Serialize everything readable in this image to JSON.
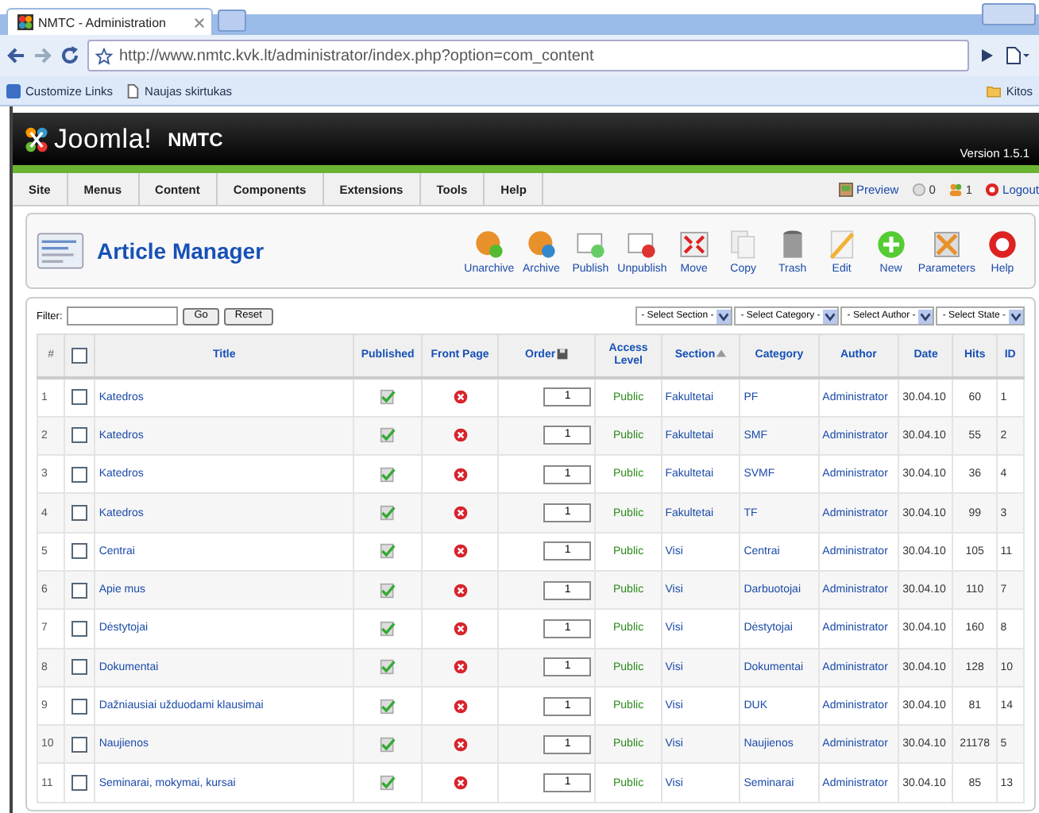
{
  "browser": {
    "tab_title": "NMTC - Administration",
    "url": "http://www.nmtc.kvk.lt/administrator/index.php?option=com_content",
    "bookmarks": [
      "Customize Links",
      "Naujas skirtukas"
    ],
    "other_bookmarks": "Kitos"
  },
  "header": {
    "brand": "Joomla!",
    "site_name": "NMTC",
    "version": "Version 1.5.1"
  },
  "menu": [
    "Site",
    "Menus",
    "Content",
    "Components",
    "Extensions",
    "Tools",
    "Help"
  ],
  "status": [
    {
      "kind": "preview",
      "label": "Preview"
    },
    {
      "kind": "messages",
      "label": "0"
    },
    {
      "kind": "users",
      "label": "1"
    },
    {
      "kind": "logout",
      "label": "Logout"
    }
  ],
  "toolbar": {
    "title": "Article Manager",
    "buttons": [
      {
        "kind": "unarchive",
        "label": "Unarchive"
      },
      {
        "kind": "archive",
        "label": "Archive"
      },
      {
        "kind": "publish",
        "label": "Publish"
      },
      {
        "kind": "unpublish",
        "label": "Unpublish"
      },
      {
        "kind": "move",
        "label": "Move"
      },
      {
        "kind": "copy",
        "label": "Copy"
      },
      {
        "kind": "trash",
        "label": "Trash"
      },
      {
        "kind": "edit",
        "label": "Edit"
      },
      {
        "kind": "new",
        "label": "New"
      },
      {
        "kind": "parameters",
        "label": "Parameters"
      },
      {
        "kind": "help",
        "label": "Help"
      }
    ]
  },
  "filter": {
    "label": "Filter:",
    "go": "Go",
    "reset": "Reset",
    "selects": [
      "- Select Section -",
      "- Select Category -",
      "- Select Author -",
      "- Select State -"
    ]
  },
  "table": {
    "columns": [
      {
        "label": "#",
        "kind": "text"
      },
      {
        "kind": "checkbox"
      },
      {
        "label": "Title",
        "kind": "text"
      },
      {
        "label": "Published",
        "kind": "text"
      },
      {
        "label": "Front Page",
        "kind": "text"
      },
      {
        "label": "Order",
        "kind": "order"
      },
      {
        "label": "Access Level",
        "kind": "text"
      },
      {
        "label": "Section",
        "kind": "sorted"
      },
      {
        "label": "Category",
        "kind": "text"
      },
      {
        "label": "Author",
        "kind": "text"
      },
      {
        "label": "Date",
        "kind": "text"
      },
      {
        "label": "Hits",
        "kind": "text"
      },
      {
        "label": "ID",
        "kind": "text"
      }
    ],
    "header_checked": false,
    "rows": [
      {
        "num": "1",
        "checked": false,
        "title": "Katedros",
        "published": true,
        "front_page": false,
        "order": "1",
        "access": "Public",
        "section": "Fakultetai",
        "category": "PF",
        "author": "Administrator",
        "date": "30.04.10",
        "hits": "60",
        "id": "1"
      },
      {
        "num": "2",
        "checked": false,
        "title": "Katedros",
        "published": true,
        "front_page": false,
        "order": "1",
        "access": "Public",
        "section": "Fakultetai",
        "category": "SMF",
        "author": "Administrator",
        "date": "30.04.10",
        "hits": "55",
        "id": "2"
      },
      {
        "num": "3",
        "checked": false,
        "title": "Katedros",
        "published": true,
        "front_page": false,
        "order": "1",
        "access": "Public",
        "section": "Fakultetai",
        "category": "SVMF",
        "author": "Administrator",
        "date": "30.04.10",
        "hits": "36",
        "id": "4"
      },
      {
        "num": "4",
        "checked": false,
        "title": "Katedros",
        "published": true,
        "front_page": false,
        "order": "1",
        "access": "Public",
        "section": "Fakultetai",
        "category": "TF",
        "author": "Administrator",
        "date": "30.04.10",
        "hits": "99",
        "id": "3"
      },
      {
        "num": "5",
        "checked": false,
        "title": "Centrai",
        "published": true,
        "front_page": false,
        "order": "1",
        "access": "Public",
        "section": "Visi",
        "category": "Centrai",
        "author": "Administrator",
        "date": "30.04.10",
        "hits": "105",
        "id": "11"
      },
      {
        "num": "6",
        "checked": false,
        "title": "Apie mus",
        "published": true,
        "front_page": false,
        "order": "1",
        "access": "Public",
        "section": "Visi",
        "category": "Darbuotojai",
        "author": "Administrator",
        "date": "30.04.10",
        "hits": "110",
        "id": "7"
      },
      {
        "num": "7",
        "checked": false,
        "title": "Dėstytojai",
        "published": true,
        "front_page": false,
        "order": "1",
        "access": "Public",
        "section": "Visi",
        "category": "Dėstytojai",
        "author": "Administrator",
        "date": "30.04.10",
        "hits": "160",
        "id": "8"
      },
      {
        "num": "8",
        "checked": false,
        "title": "Dokumentai",
        "published": true,
        "front_page": false,
        "order": "1",
        "access": "Public",
        "section": "Visi",
        "category": "Dokumentai",
        "author": "Administrator",
        "date": "30.04.10",
        "hits": "128",
        "id": "10"
      },
      {
        "num": "9",
        "checked": false,
        "title": "Dažniausiai užduodami klausimai",
        "published": true,
        "front_page": false,
        "order": "1",
        "access": "Public",
        "section": "Visi",
        "category": "DUK",
        "author": "Administrator",
        "date": "30.04.10",
        "hits": "81",
        "id": "14"
      },
      {
        "num": "10",
        "checked": false,
        "title": "Naujienos",
        "published": true,
        "front_page": false,
        "order": "1",
        "access": "Public",
        "section": "Visi",
        "category": "Naujienos",
        "author": "Administrator",
        "date": "30.04.10",
        "hits": "21178",
        "id": "5"
      },
      {
        "num": "11",
        "checked": false,
        "title": "Seminarai, mokymai, kursai",
        "published": true,
        "front_page": false,
        "order": "1",
        "access": "Public",
        "section": "Visi",
        "category": "Seminarai",
        "author": "Administrator",
        "date": "30.04.10",
        "hits": "85",
        "id": "13"
      }
    ]
  }
}
